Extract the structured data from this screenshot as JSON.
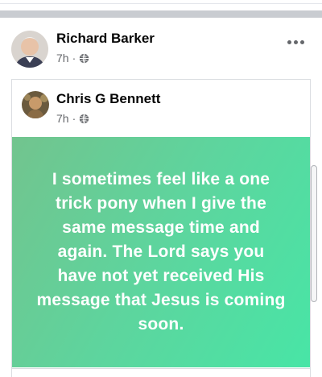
{
  "post": {
    "author": "Richard Barker",
    "time": "7h",
    "privacy_icon": "globe-icon",
    "more_icon": "more-horizontal-icon"
  },
  "shared_post": {
    "author": "Chris G Bennett",
    "time": "7h",
    "privacy_icon": "globe-icon",
    "status_text": "I sometimes feel like a one trick pony when I give the same message time and again. The Lord says you have not yet received His message that Jesus is coming soon.",
    "background_gradient": [
      "#72c48e",
      "#48e5a6"
    ]
  },
  "colors": {
    "name_text": "#050505",
    "meta_text": "#65676b",
    "divider": "#c9ccd1"
  }
}
